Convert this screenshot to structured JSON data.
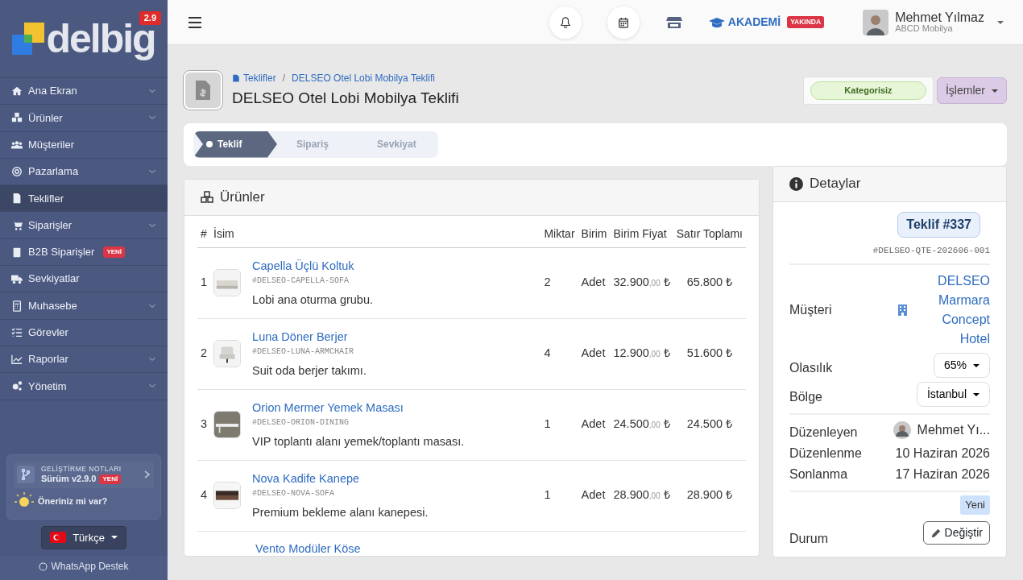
{
  "sidebar": {
    "logo": "delbig",
    "version": "2.9",
    "items": [
      {
        "label": "Ana Ekran",
        "has_submenu": true,
        "selected": false
      },
      {
        "label": "Ürünler",
        "has_submenu": true,
        "selected": false
      },
      {
        "label": "Müşteriler",
        "has_submenu": false,
        "selected": false
      },
      {
        "label": "Pazarlama",
        "has_submenu": true,
        "selected": false
      },
      {
        "label": "Teklifler",
        "has_submenu": false,
        "selected": true
      },
      {
        "label": "Siparişler",
        "has_submenu": true,
        "selected": false
      },
      {
        "label": "B2B Siparişler",
        "badge": "YENİ",
        "has_submenu": false,
        "selected": false
      },
      {
        "label": "Sevkiyatlar",
        "has_submenu": false,
        "selected": false
      },
      {
        "label": "Muhasebe",
        "has_submenu": true,
        "selected": false
      },
      {
        "label": "Görevler",
        "has_submenu": false,
        "selected": false
      },
      {
        "label": "Raporlar",
        "has_submenu": true,
        "selected": false
      },
      {
        "label": "Yönetim",
        "has_submenu": true,
        "selected": false
      }
    ],
    "release_notes": {
      "title": "GELİŞTİRME NOTLARI",
      "version": "Sürüm v2.9.0",
      "badge": "YENİ"
    },
    "suggestion": "Öneriniz mi var?",
    "language": "Türkçe",
    "support": "WhatsApp Destek"
  },
  "topbar": {
    "academy": "AKADEMİ",
    "academy_badge": "YAKINDA",
    "user_name": "Mehmet Yılmaz",
    "company": "ABCD Mobilya"
  },
  "header": {
    "breadcrumb_separator": "/",
    "breadcrumb": [
      "Teklifler",
      "DELSEO Otel Lobi Mobilya Teklifi"
    ],
    "title": "DELSEO Otel Lobi Mobilya Teklifi",
    "category": "Kategorisiz",
    "actions": "İşlemler"
  },
  "steps": [
    {
      "label": "Teklif",
      "selected": true
    },
    {
      "label": "Sipariş",
      "selected": false
    },
    {
      "label": "Sevkiyat",
      "selected": false
    }
  ],
  "products": {
    "title": "Ürünler",
    "columns": [
      "#",
      "İsim",
      "Miktar",
      "Birim",
      "Birim Fiyat",
      "Satır Toplamı"
    ],
    "rows": [
      {
        "no": "1",
        "name": "Capella Üçlü Koltuk",
        "sku": "#DELSEO-CAPELLA-SOFA",
        "description": "Lobi ana oturma grubu.",
        "quantity": "2",
        "unit": "Adet",
        "price": {
          "amount": "32.900",
          "decimals": ",00",
          "currency": "₺"
        },
        "total": "65.800 ₺"
      },
      {
        "no": "2",
        "name": "Luna Döner Berjer",
        "sku": "#DELSEO-LUNA-ARMCHAIR",
        "description": "Suit oda berjer takımı.",
        "quantity": "4",
        "unit": "Adet",
        "price": {
          "amount": "12.900",
          "decimals": ",00",
          "currency": "₺"
        },
        "total": "51.600 ₺"
      },
      {
        "no": "3",
        "name": "Orion Mermer Yemek Masası",
        "sku": "#DELSEO-ORION-DINING",
        "description": "VIP toplantı alanı yemek/toplantı masası.",
        "quantity": "1",
        "unit": "Adet",
        "price": {
          "amount": "24.500",
          "decimals": ",00",
          "currency": "₺"
        },
        "total": "24.500 ₺"
      },
      {
        "no": "4",
        "name": "Nova Kadife Kanepe",
        "sku": "#DELSEO-NOVA-SOFA",
        "description": "Premium bekleme alanı kanepesi.",
        "quantity": "1",
        "unit": "Adet",
        "price": {
          "amount": "28.900",
          "decimals": ",00",
          "currency": "₺"
        },
        "total": "28.900 ₺"
      },
      {
        "name": "Vento Modüler Köse"
      }
    ]
  },
  "details": {
    "title": "Detaylar",
    "quote": "Teklif #337",
    "code": "#DELSEO-QTE-202606-001",
    "rows": [
      {
        "kind": "link",
        "label": "Müşteri",
        "value": "DELSEO Marmara Concept Hotel"
      },
      {
        "kind": "select",
        "label": "Olasılık",
        "value": "65%"
      },
      {
        "kind": "select",
        "label": "Bölge",
        "value": "İstanbul"
      },
      {
        "kind": "divider"
      },
      {
        "kind": "user",
        "label": "Düzenleyen",
        "value": "Mehmet Yı..."
      },
      {
        "kind": "text",
        "label": "Düzenlenme",
        "value": "10 Haziran 2026"
      },
      {
        "kind": "text",
        "label": "Sonlanma",
        "value": "17 Haziran 2026"
      },
      {
        "kind": "divider"
      },
      {
        "kind": "status",
        "label": "Durum",
        "badge": "Yeni",
        "button": "Değiştir"
      }
    ]
  }
}
